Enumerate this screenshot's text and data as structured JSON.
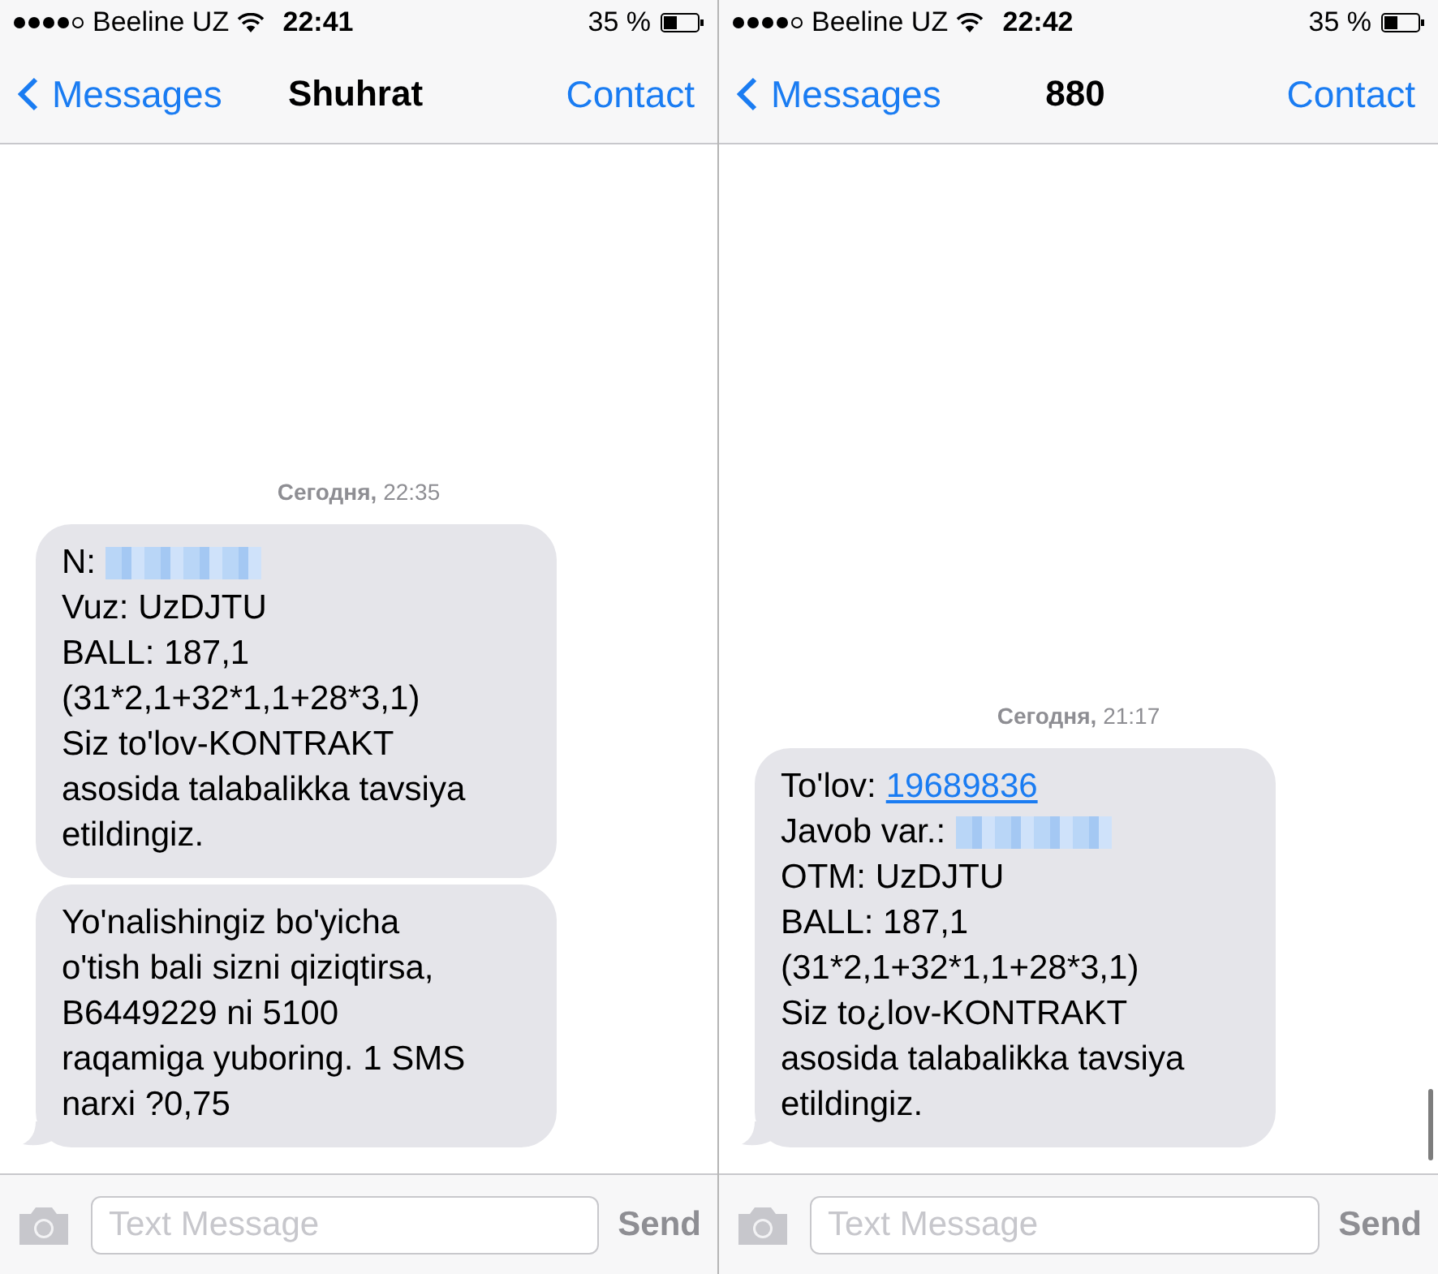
{
  "screens": [
    {
      "status_bar": {
        "carrier": "Beeline UZ",
        "time": "22:41",
        "battery": "35 %"
      },
      "nav_bar": {
        "back": "Messages",
        "title": "Shuhrat",
        "action": "Contact"
      },
      "timestamp": "**Сегодня,** 22:35",
      "messages": [
        {
          "lines": [
            [
              {
                "kind": "text",
                "text": "N:"
              },
              {
                "kind": "redacted"
              }
            ],
            [
              {
                "kind": "text",
                "text": "Vuz: UzDJTU"
              }
            ],
            [
              {
                "kind": "text",
                "text": "BALL: 187,1"
              }
            ],
            [
              {
                "kind": "text",
                "text": "(31*2,1+32*1,1+28*3,1)"
              }
            ],
            [
              {
                "kind": "text",
                "text": "Siz to'lov-KONTRAKT"
              }
            ],
            [
              {
                "kind": "text",
                "text": "asosida talabalikka tavsiya"
              }
            ],
            [
              {
                "kind": "text",
                "text": "etildingiz."
              }
            ]
          ]
        },
        {
          "lines": [
            [
              {
                "kind": "text",
                "text": "Yo'nalishingiz bo'yicha"
              }
            ],
            [
              {
                "kind": "text",
                "text": "o'tish bali sizni qiziqtirsa,"
              }
            ],
            [
              {
                "kind": "text",
                "text": "B6449229 ni 5100"
              }
            ],
            [
              {
                "kind": "text",
                "text": "raqamiga yuboring. 1 SMS"
              }
            ],
            [
              {
                "kind": "text",
                "text": "narxi ?0,75"
              }
            ]
          ]
        }
      ],
      "scroll_indicator": false,
      "composer": {
        "placeholder": "Text Message",
        "send": "Send"
      }
    },
    {
      "status_bar": {
        "carrier": "Beeline UZ",
        "time": "22:42",
        "battery": "35 %"
      },
      "nav_bar": {
        "back": "Messages",
        "title": "880",
        "action": "Contact"
      },
      "timestamp": "**Сегодня,** 21:17",
      "messages": [
        {
          "lines": [
            [
              {
                "kind": "text",
                "text": "To'lov:"
              },
              {
                "kind": "link",
                "text": "19689836"
              }
            ],
            [
              {
                "kind": "text",
                "text": "Javob var.:"
              },
              {
                "kind": "redacted"
              }
            ],
            [
              {
                "kind": "text",
                "text": "OTM: UzDJTU"
              }
            ],
            [
              {
                "kind": "text",
                "text": "BALL: 187,1"
              }
            ],
            [
              {
                "kind": "text",
                "text": "(31*2,1+32*1,1+28*3,1)"
              }
            ],
            [
              {
                "kind": "text",
                "text": "Siz to¿lov-KONTRAKT"
              }
            ],
            [
              {
                "kind": "text",
                "text": "asosida talabalikka tavsiya"
              }
            ],
            [
              {
                "kind": "text",
                "text": "etildingiz."
              }
            ]
          ]
        }
      ],
      "scroll_indicator": true,
      "composer": {
        "placeholder": "Text Message",
        "send": "Send"
      }
    }
  ]
}
